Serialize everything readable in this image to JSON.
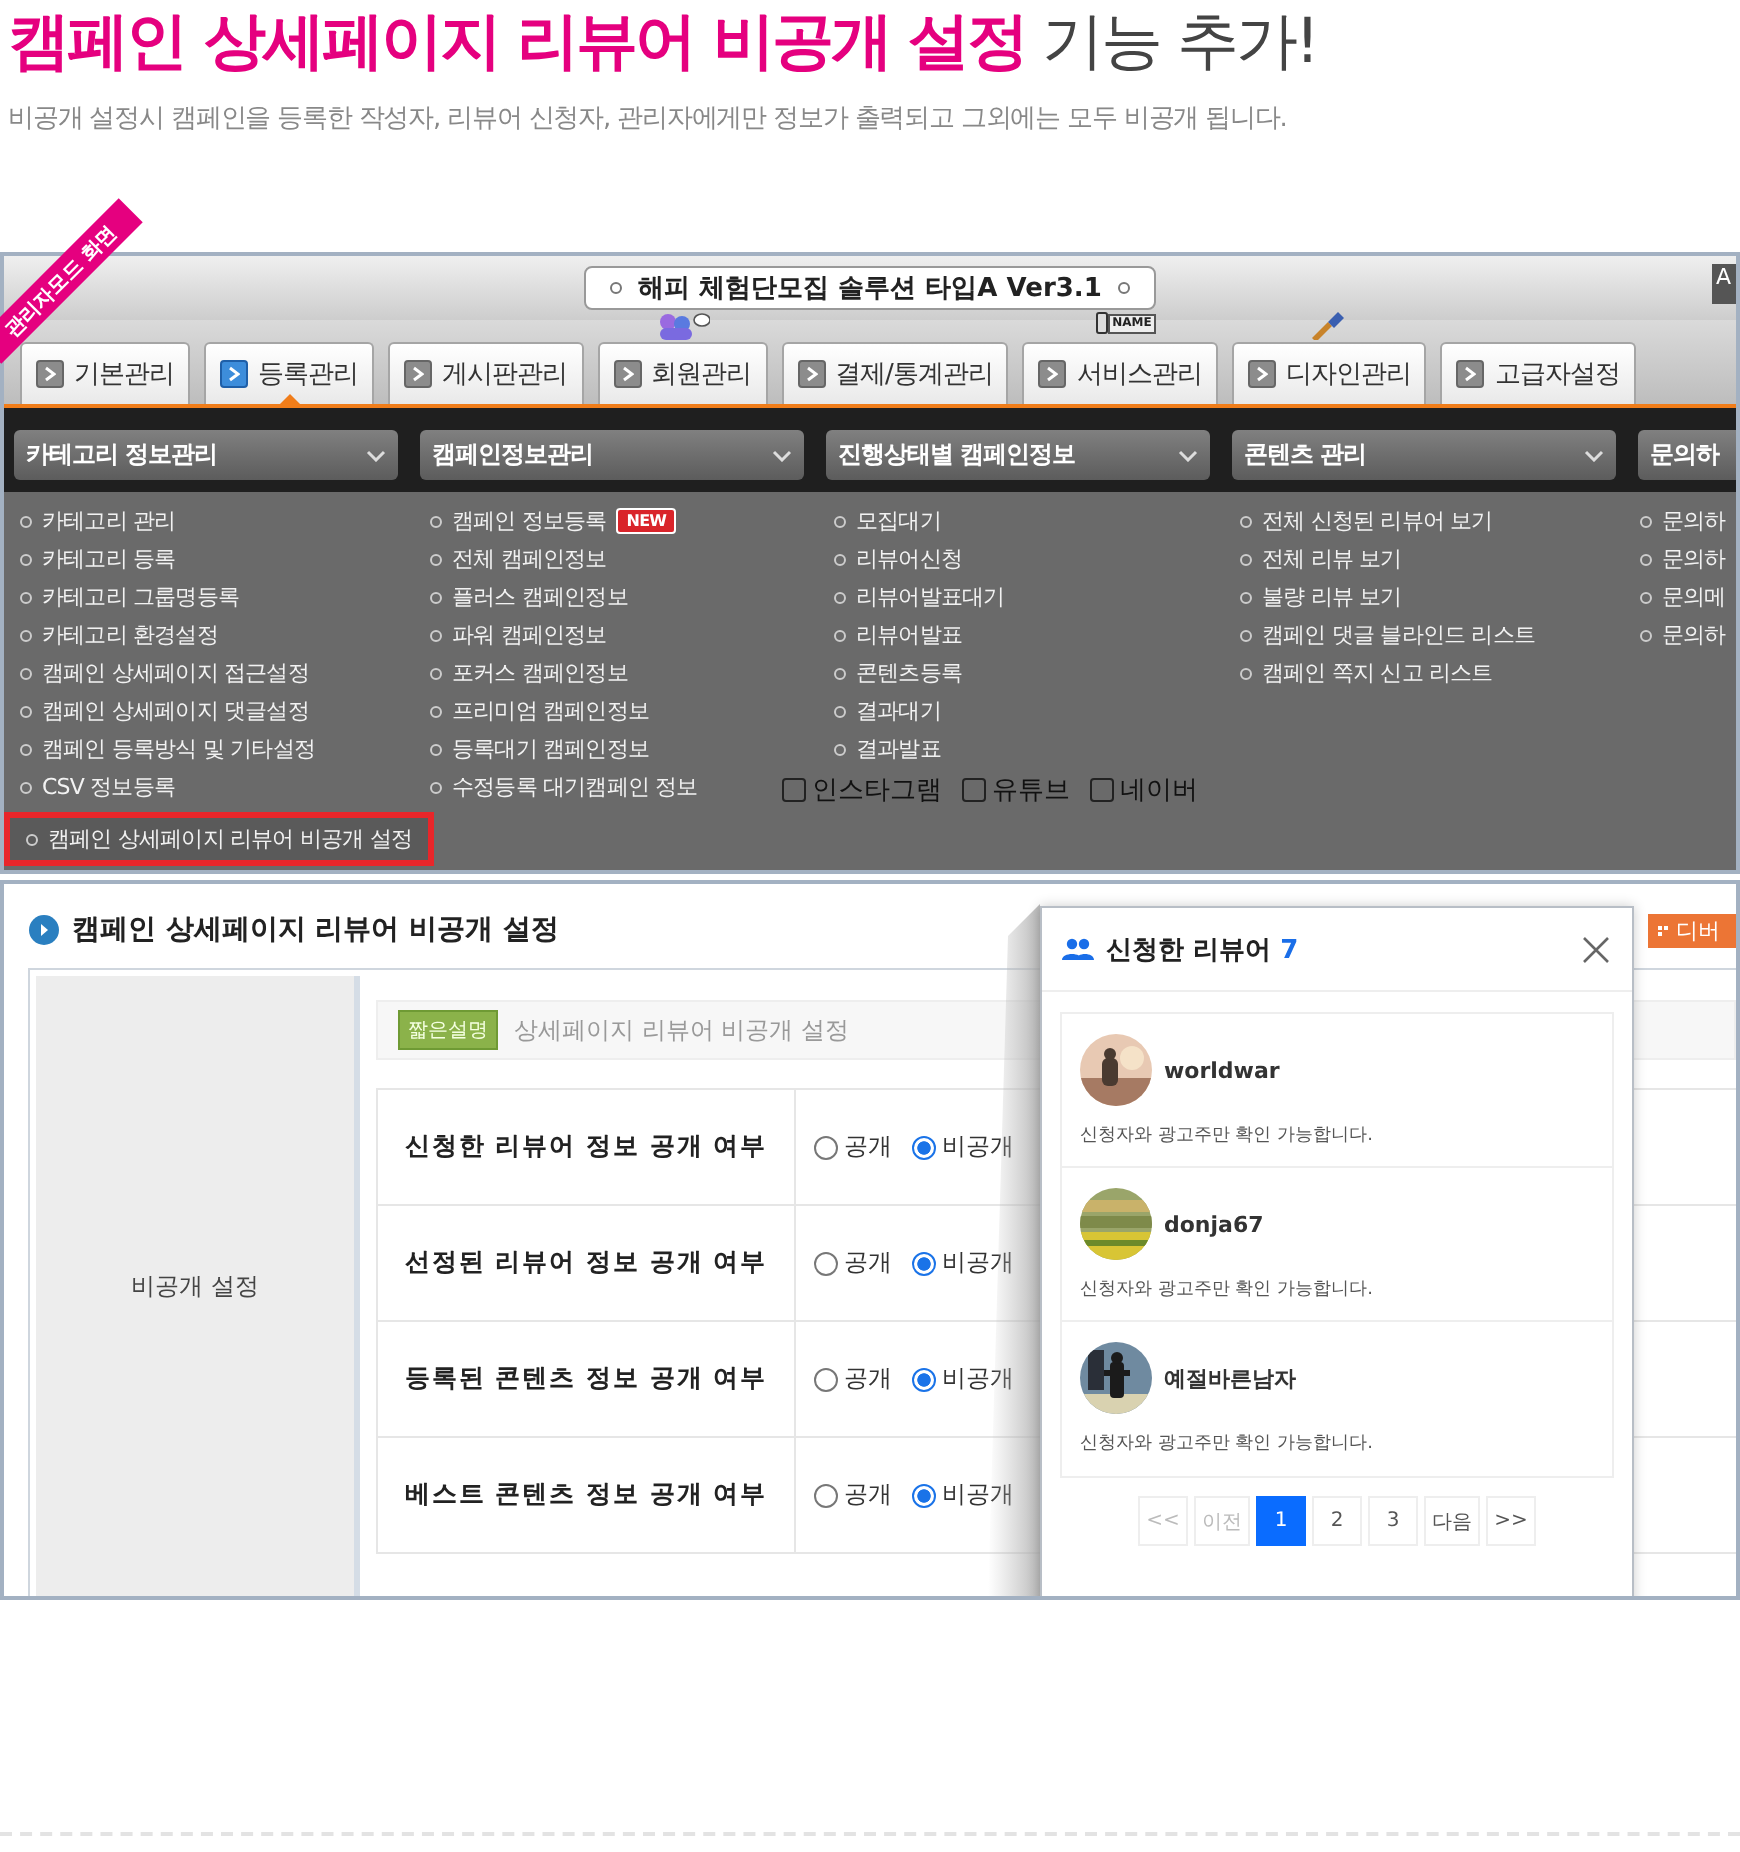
{
  "headline": {
    "highlight": "캠페인 상세페이지 리뷰어 비공개 설정",
    "rest": "기능 추가!"
  },
  "subtitle": "비공개 설정시 캠페인을 등록한 작성자, 리뷰어 신청자, 관리자에게만 정보가 출력되고 그외에는 모두 비공개 됩니다.",
  "admin_screen": {
    "ribbon": "관리자모드 화면",
    "title": "해피 체험단모집 솔루션 타입A Ver3.1",
    "corner_button": "A",
    "tabs": [
      {
        "label": "기본관리",
        "selected": false,
        "kind": "plain"
      },
      {
        "label": "등록관리",
        "selected": true,
        "kind": "plain"
      },
      {
        "label": "게시판관리",
        "selected": false,
        "kind": "plain"
      },
      {
        "label": "회원관리",
        "selected": false,
        "kind": "people"
      },
      {
        "label": "결제/통계관리",
        "selected": false,
        "kind": "plain"
      },
      {
        "label": "서비스관리",
        "selected": false,
        "kind": "namecard",
        "badge_text": "NAME"
      },
      {
        "label": "디자인관리",
        "selected": false,
        "kind": "brush"
      },
      {
        "label": "고급자설정",
        "selected": false,
        "kind": "plain"
      }
    ],
    "menu_headers": [
      "카테고리 정보관리",
      "캠페인정보관리",
      "진행상태별 캠페인정보",
      "콘텐츠 관리",
      "문의하"
    ],
    "menu_columns": [
      {
        "items": [
          {
            "label": "카테고리 관리"
          },
          {
            "label": "카테고리 등록"
          },
          {
            "label": "카테고리 그룹명등록"
          },
          {
            "label": "카테고리 환경설정"
          },
          {
            "label": "캠페인 상세페이지 접근설정"
          },
          {
            "label": "캠페인 상세페이지 댓글설정"
          },
          {
            "label": "캠페인 등록방식 및 기타설정"
          },
          {
            "label": "CSV 정보등록"
          },
          {
            "label": "캠페인 상세페이지 리뷰어 비공개 설정",
            "highlighted": true
          }
        ]
      },
      {
        "items": [
          {
            "label": "캠페인 정보등록",
            "badge": "NEW"
          },
          {
            "label": "전체 캠페인정보"
          },
          {
            "label": "플러스 캠페인정보"
          },
          {
            "label": "파워 캠페인정보"
          },
          {
            "label": "포커스 캠페인정보"
          },
          {
            "label": "프리미엄 캠페인정보"
          },
          {
            "label": "등록대기 캠페인정보"
          },
          {
            "label": "수정등록 대기캠페인 정보"
          }
        ]
      },
      {
        "items": [
          {
            "label": "모집대기"
          },
          {
            "label": "리뷰어신청"
          },
          {
            "label": "리뷰어발표대기"
          },
          {
            "label": "리뷰어발표"
          },
          {
            "label": "콘텐츠등록"
          },
          {
            "label": "결과대기"
          },
          {
            "label": "결과발표"
          }
        ]
      },
      {
        "items": [
          {
            "label": "전체 신청된 리뷰어 보기"
          },
          {
            "label": "전체 리뷰 보기"
          },
          {
            "label": "불량 리뷰 보기"
          },
          {
            "label": "캠페인 댓글 블라인드 리스트"
          },
          {
            "label": "캠페인 쪽지 신고 리스트"
          }
        ]
      },
      {
        "items": [
          {
            "label": "문의하"
          },
          {
            "label": "문의하"
          },
          {
            "label": "문의메"
          },
          {
            "label": "문의하"
          }
        ]
      }
    ],
    "sns_options": [
      {
        "label": "인스타그램",
        "checked": false
      },
      {
        "label": "유튜브",
        "checked": false
      },
      {
        "label": "네이버",
        "checked": false
      }
    ]
  },
  "settings_screen": {
    "title": "캠페인 상세페이지 리뷰어 비공개 설정",
    "debug_button": "디버",
    "section_label": "비공개 설정",
    "desc_badge": "짧은설명",
    "description": "상세페이지 리뷰어 비공개 설정",
    "rows": [
      {
        "label": "신청한 리뷰어 정보 공개 여부",
        "options": [
          {
            "label": "공개",
            "selected": false
          },
          {
            "label": "비공개",
            "selected": true
          }
        ]
      },
      {
        "label": "선정된 리뷰어 정보 공개 여부",
        "options": [
          {
            "label": "공개",
            "selected": false
          },
          {
            "label": "비공개",
            "selected": true
          }
        ]
      },
      {
        "label": "등록된 콘텐츠 정보 공개 여부",
        "options": [
          {
            "label": "공개",
            "selected": false
          },
          {
            "label": "비공개",
            "selected": true
          }
        ]
      },
      {
        "label": "베스트 콘텐츠 정보 공개 여부",
        "options": [
          {
            "label": "공개",
            "selected": false
          },
          {
            "label": "비공개",
            "selected": true
          }
        ]
      }
    ],
    "popup": {
      "title": "신청한 리뷰어",
      "count": "7",
      "reviewers": [
        {
          "name": "worldwar",
          "note": "신청자와 광고주만 확인 가능합니다."
        },
        {
          "name": "donja67",
          "note": "신청자와 광고주만 확인 가능합니다."
        },
        {
          "name": "예절바른남자",
          "note": "신청자와 광고주만 확인 가능합니다."
        }
      ],
      "pages": [
        {
          "label": "<<",
          "selected": false,
          "disabled": true
        },
        {
          "label": "이전",
          "selected": false,
          "disabled": true
        },
        {
          "label": "1",
          "selected": true,
          "disabled": false
        },
        {
          "label": "2",
          "selected": false,
          "disabled": false
        },
        {
          "label": "3",
          "selected": false,
          "disabled": false
        },
        {
          "label": "다음",
          "selected": false,
          "disabled": false
        },
        {
          "label": ">>",
          "selected": false,
          "disabled": false
        }
      ]
    }
  }
}
